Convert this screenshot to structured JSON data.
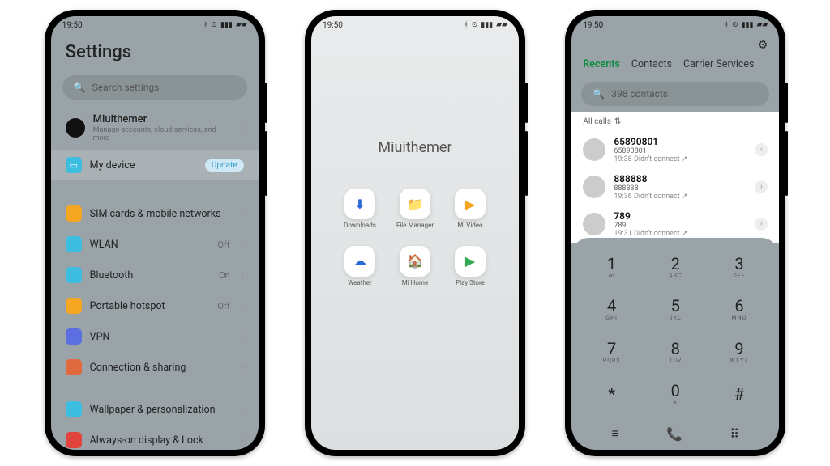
{
  "statusbar": {
    "time": "19:50"
  },
  "phone1": {
    "title": "Settings",
    "search_placeholder": "Search settings",
    "account": {
      "name": "Miuithemer",
      "sub": "Manage accounts, cloud services, and more"
    },
    "mydevice": {
      "label": "My device",
      "badge": "Update"
    },
    "rows": [
      {
        "label": "SIM cards & mobile networks",
        "tail": "",
        "color": "#f5a623"
      },
      {
        "label": "WLAN",
        "tail": "Off",
        "color": "#3dbde0"
      },
      {
        "label": "Bluetooth",
        "tail": "On",
        "color": "#3dbde0"
      },
      {
        "label": "Portable hotspot",
        "tail": "Off",
        "color": "#f5a623"
      },
      {
        "label": "VPN",
        "tail": "",
        "color": "#5b6fe0"
      },
      {
        "label": "Connection & sharing",
        "tail": "",
        "color": "#e06a3d"
      },
      {
        "label": "Wallpaper & personalization",
        "tail": "",
        "color": "#3dbde0"
      },
      {
        "label": "Always-on display & Lock",
        "tail": "",
        "color": "#e0443d"
      }
    ]
  },
  "phone2": {
    "title": "Miuithemer",
    "apps": [
      {
        "label": "Downloads",
        "glyph": "⬇",
        "tint": "#2a6ad6"
      },
      {
        "label": "File Manager",
        "glyph": "📁",
        "tint": "#f5a623"
      },
      {
        "label": "Mi Video",
        "glyph": "▶",
        "tint": "#f5a623"
      },
      {
        "label": "Weather",
        "glyph": "☁",
        "tint": "#2a6ad6"
      },
      {
        "label": "Mi Home",
        "glyph": "🏠",
        "tint": "#2a6ad6"
      },
      {
        "label": "Play Store",
        "glyph": "▶",
        "tint": "#34a853"
      }
    ]
  },
  "phone3": {
    "tabs": [
      "Recents",
      "Contacts",
      "Carrier Services"
    ],
    "active_tab": 0,
    "search_placeholder": "398 contacts",
    "filter": "All calls",
    "calls": [
      {
        "name": "65890801",
        "num": "65890801",
        "meta": "19:38 Didn't connect ↗"
      },
      {
        "name": "888888",
        "num": "888888",
        "meta": "19:36 Didn't connect ↗"
      },
      {
        "name": "789",
        "num": "789",
        "meta": "19:31 Didn't connect ↗"
      }
    ],
    "keys": [
      {
        "d": "1",
        "l": "∞"
      },
      {
        "d": "2",
        "l": "ABC"
      },
      {
        "d": "3",
        "l": "DEF"
      },
      {
        "d": "4",
        "l": "GHI"
      },
      {
        "d": "5",
        "l": "JKL"
      },
      {
        "d": "6",
        "l": "MNO"
      },
      {
        "d": "7",
        "l": "PQRS"
      },
      {
        "d": "8",
        "l": "TUV"
      },
      {
        "d": "9",
        "l": "WXYZ"
      },
      {
        "d": "*",
        "l": ""
      },
      {
        "d": "0",
        "l": "+"
      },
      {
        "d": "#",
        "l": ""
      }
    ]
  }
}
